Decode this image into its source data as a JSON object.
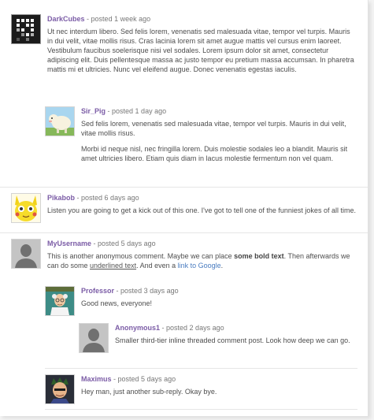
{
  "comments": [
    {
      "author": "DarkCubes",
      "posted": "posted 1 week ago",
      "avatar": "darkcubes-avatar",
      "paragraphs": [
        "Ut nec interdum libero. Sed felis lorem, venenatis sed malesuada vitae, tempor vel turpis. Mauris in dui velit, vitae mollis risus. Cras lacinia lorem sit amet augue mattis vel cursus enim laoreet. Vestibulum faucibus soelerisque nisi vel sodales. Lorem ipsum dolor sit amet, consectetur adipiscing elit. Duis pellentesque massa ac justo tempor eu pretium massa accumsan. In pharetra mattis mi et ultricies. Nunc vel eleifend augue. Donec venenatis egestas iaculis."
      ]
    },
    {
      "author": "Sir_Pig",
      "posted": "posted 1 day ago",
      "avatar": "sheep-avatar",
      "paragraphs": [
        "Sed felis lorem, venenatis sed malesuada vitae, tempor vel turpis. Mauris in dui velit, vitae mollis risus.",
        "Morbi id neque nisl, nec fringilla lorem. Duis molestie sodales leo a blandit. Mauris sit amet ultricies libero. Etiam quis diam in lacus molestie fermentum non vel quam."
      ]
    },
    {
      "author": "Pikabob",
      "posted": "posted 6 days ago",
      "avatar": "pikabob-avatar",
      "paragraphs": [
        "Listen you are going to get a kick out of this one. I've got to tell one of the funniest jokes of all time."
      ]
    },
    {
      "author": "MyUsername",
      "posted": "posted 5 days ago",
      "avatar": "default-user-avatar",
      "rich": {
        "t1": "This is another anonymous comment. Maybe we can place ",
        "bold": "some bold text",
        "t2": ". Then afterwards we can do some ",
        "underline": "underlined text",
        "t3": ". And even a ",
        "link": "link to Google",
        "t4": "."
      }
    },
    {
      "author": "Professor",
      "posted": "posted 3 days ago",
      "avatar": "professor-avatar",
      "paragraphs": [
        "Good news, everyone!"
      ]
    },
    {
      "author": "Anonymous1",
      "posted": "posted 2 days ago",
      "avatar": "default-user-avatar",
      "paragraphs": [
        "Smaller third-tier inline threaded comment post. Look how deep we can go."
      ]
    },
    {
      "author": "Maximus",
      "posted": "posted 5 days ago",
      "avatar": "maximus-avatar",
      "paragraphs": [
        "Hey man, just another sub-reply. Okay bye."
      ]
    }
  ],
  "separator": "-",
  "colors": {
    "author": "#7b5ca6",
    "link": "#4a7cc0",
    "text": "#4e4e4e"
  }
}
